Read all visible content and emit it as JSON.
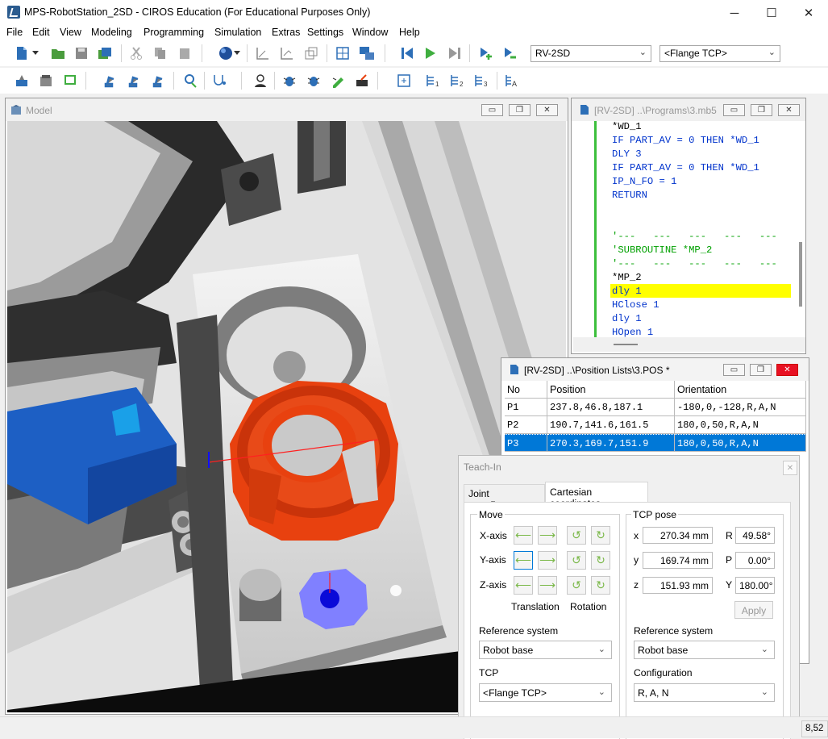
{
  "window": {
    "title": "MPS-RobotStation_2SD - CIROS Education (For Educational Purposes Only)",
    "minimize": "─",
    "maximize": "☐",
    "close": "✕"
  },
  "menu": [
    "File",
    "Edit",
    "View",
    "Modeling",
    "Programming",
    "Simulation",
    "Extras",
    "Settings",
    "Window",
    "Help"
  ],
  "toolbar": {
    "robot_select": "RV-2SD",
    "tcp_select": "<Flange TCP>"
  },
  "model_window": {
    "title": "Model"
  },
  "program_window": {
    "title": "[RV-2SD] ..\\Programs\\3.mb5",
    "lines": [
      "*WD_1",
      "IF PART_AV = 0 THEN *WD_1",
      "DLY 3",
      "IF PART_AV = 0 THEN *WD_1",
      "IP_N_FO = 1",
      "RETURN",
      "",
      "",
      "'---   ---   ---   ---   ---",
      "'SUBROUTINE *MP_2",
      "'---   ---   ---   ---   ---",
      "*MP_2",
      "dly 1",
      "HClose 1",
      "dly 1",
      "HOpen 1"
    ],
    "highlight_line": 12
  },
  "position_window": {
    "title": "[RV-2SD] ..\\Position Lists\\3.POS *",
    "headers": [
      "No",
      "Position",
      "Orientation"
    ],
    "rows": [
      {
        "no": "P1",
        "position": "237.8,46.8,187.1",
        "orientation": "-180,0,-128,R,A,N"
      },
      {
        "no": "P2",
        "position": "190.7,141.6,161.5",
        "orientation": "180,0,50,R,A,N"
      },
      {
        "no": "P3",
        "position": "270.3,169.7,151.9",
        "orientation": "180,0,50,R,A,N"
      }
    ],
    "selected_row": 2
  },
  "teach_in": {
    "title": "Teach-In",
    "close": "✕",
    "tabs": [
      "Joint coordinates",
      "Cartesian coordinates"
    ],
    "active_tab": 1,
    "move": {
      "label": "Move",
      "axes": [
        "X-axis",
        "Y-axis",
        "Z-axis"
      ],
      "translation": "Translation",
      "rotation": "Rotation",
      "reference_label": "Reference system",
      "reference_value": "Robot base",
      "tcp_label": "TCP",
      "tcp_value": "<Flange TCP>"
    },
    "pose": {
      "label": "TCP pose",
      "x_label": "x",
      "x": "270.34 mm",
      "y_label": "y",
      "y": "169.74 mm",
      "z_label": "z",
      "z": "151.93 mm",
      "r_label": "R",
      "r": "49.58°",
      "p_label": "P",
      "p": "0.00°",
      "yaw_label": "Y",
      "yaw": "180.00°",
      "apply": "Apply",
      "reference_label": "Reference system",
      "reference_value": "Robot base",
      "config_label": "Configuration",
      "config_value": "R, A, N"
    }
  },
  "status": {
    "coords": "8,52"
  },
  "colors": {
    "accent": "#0078d7",
    "selection": "#0078d7",
    "highlight": "#ffff00",
    "part_orange": "#e8410f",
    "code_blue": "#0033cc",
    "comment_green": "#00a000"
  }
}
